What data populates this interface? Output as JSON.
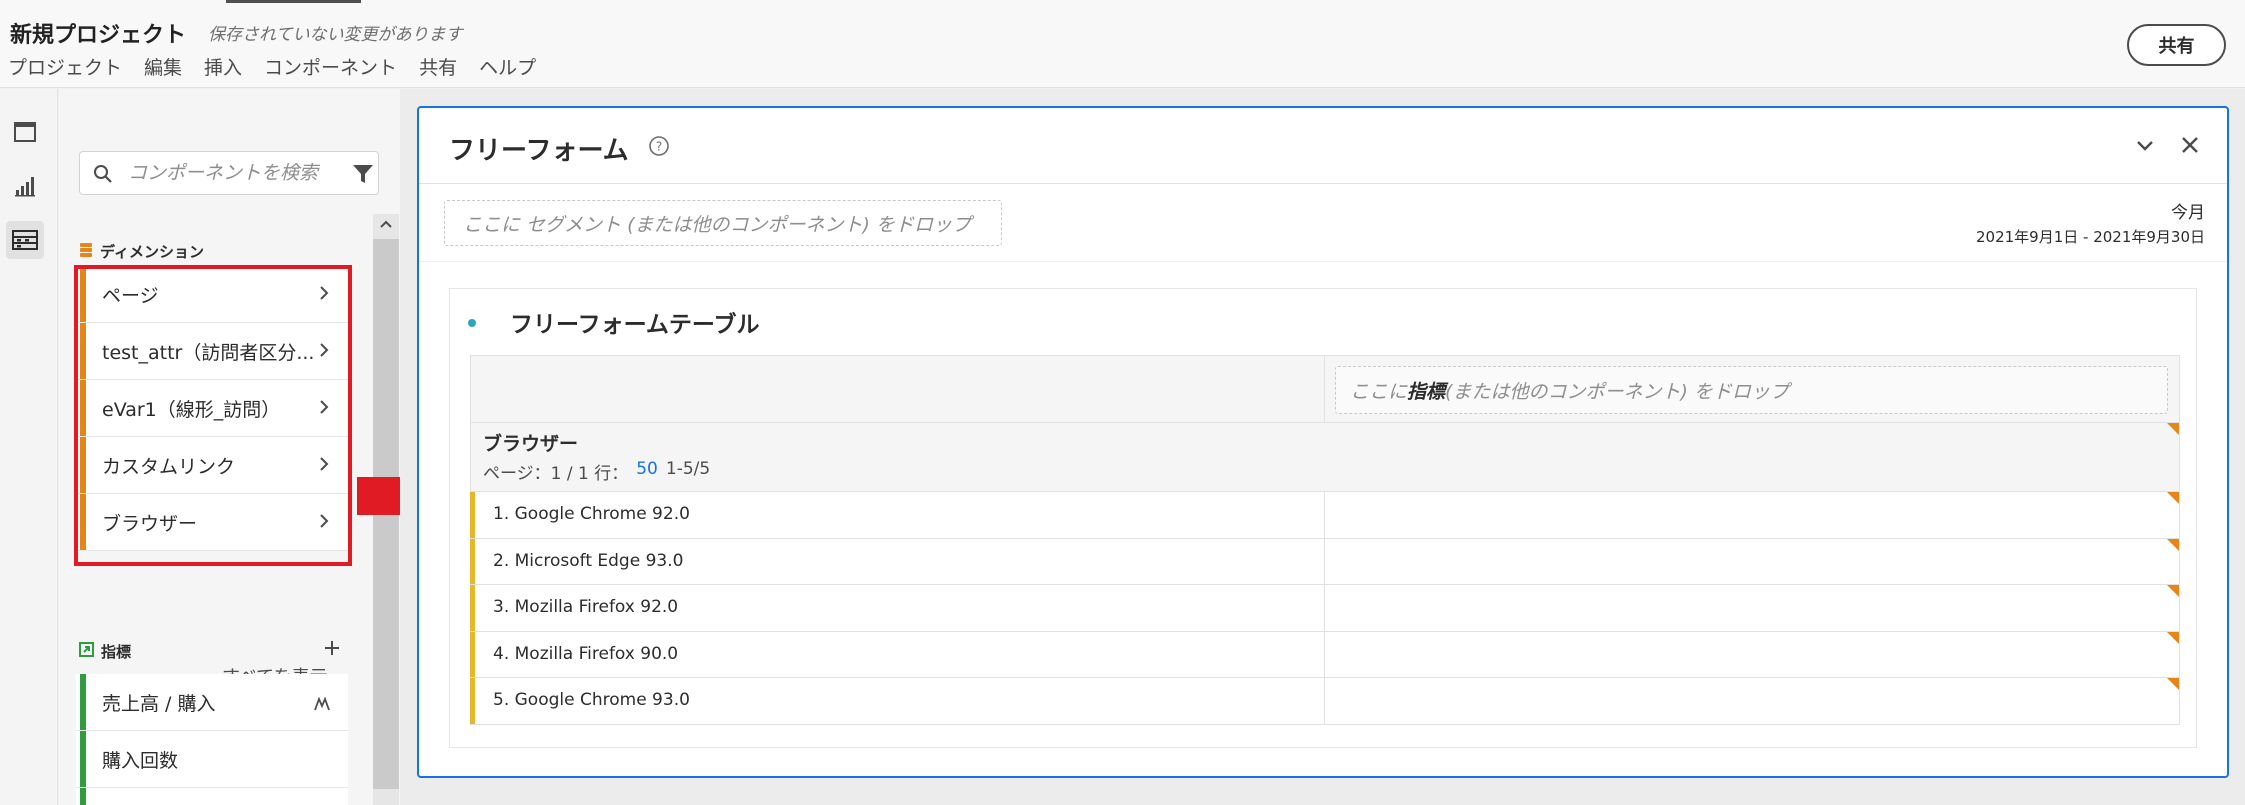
{
  "header": {
    "project_title": "新規プロジェクト",
    "unsaved_note": "保存されていない変更があります",
    "menu": [
      "プロジェクト",
      "編集",
      "挿入",
      "コンポーネント",
      "共有",
      "ヘルプ"
    ],
    "share_label": "共有"
  },
  "rail": {
    "items": [
      "panels-icon",
      "visualizations-icon",
      "components-icon"
    ],
    "active": "components-icon"
  },
  "panel": {
    "search_placeholder": "コンポーネントを検索",
    "dimensions_heading": "ディメンション",
    "dimensions": [
      "ページ",
      "test_attr（訪問者区分...",
      "eVar1（線形_訪問）",
      "カスタムリンク",
      "ブラウザー"
    ],
    "show_all": "すべてを表示",
    "metrics_heading": "指標",
    "metrics": [
      "売上高 / 購入",
      "購入回数"
    ],
    "colors": {
      "dimension_bar": "#e68619",
      "metric_bar": "#2d9d3f"
    }
  },
  "freeform": {
    "title": "フリーフォーム",
    "segment_drop": "ここに セグメント (または他のコンポーネント) をドロップ",
    "date_preset": "今月",
    "date_range": "2021年9月1日 - 2021年9月30日",
    "table_title": "フリーフォームテーブル",
    "metric_drop_prefix": "ここに ",
    "metric_drop_bold": "指標",
    "metric_drop_suffix": " (または他のコンポーネント) をドロップ",
    "dimension_name": "ブラウザー",
    "pager_label": "ページ：1 / 1 行：",
    "pager_rows": "50",
    "pager_range": "1-5/5",
    "rows": [
      "1. Google Chrome 92.0",
      "2. Microsoft Edge 93.0",
      "3. Mozilla Firefox 92.0",
      "4. Mozilla Firefox 90.0",
      "5. Google Chrome 93.0"
    ]
  },
  "colors": {
    "accent_blue": "#1473e6",
    "annotation_red": "#e01b24",
    "row_yellow": "#e6b729",
    "corner_orange": "#e68619"
  }
}
